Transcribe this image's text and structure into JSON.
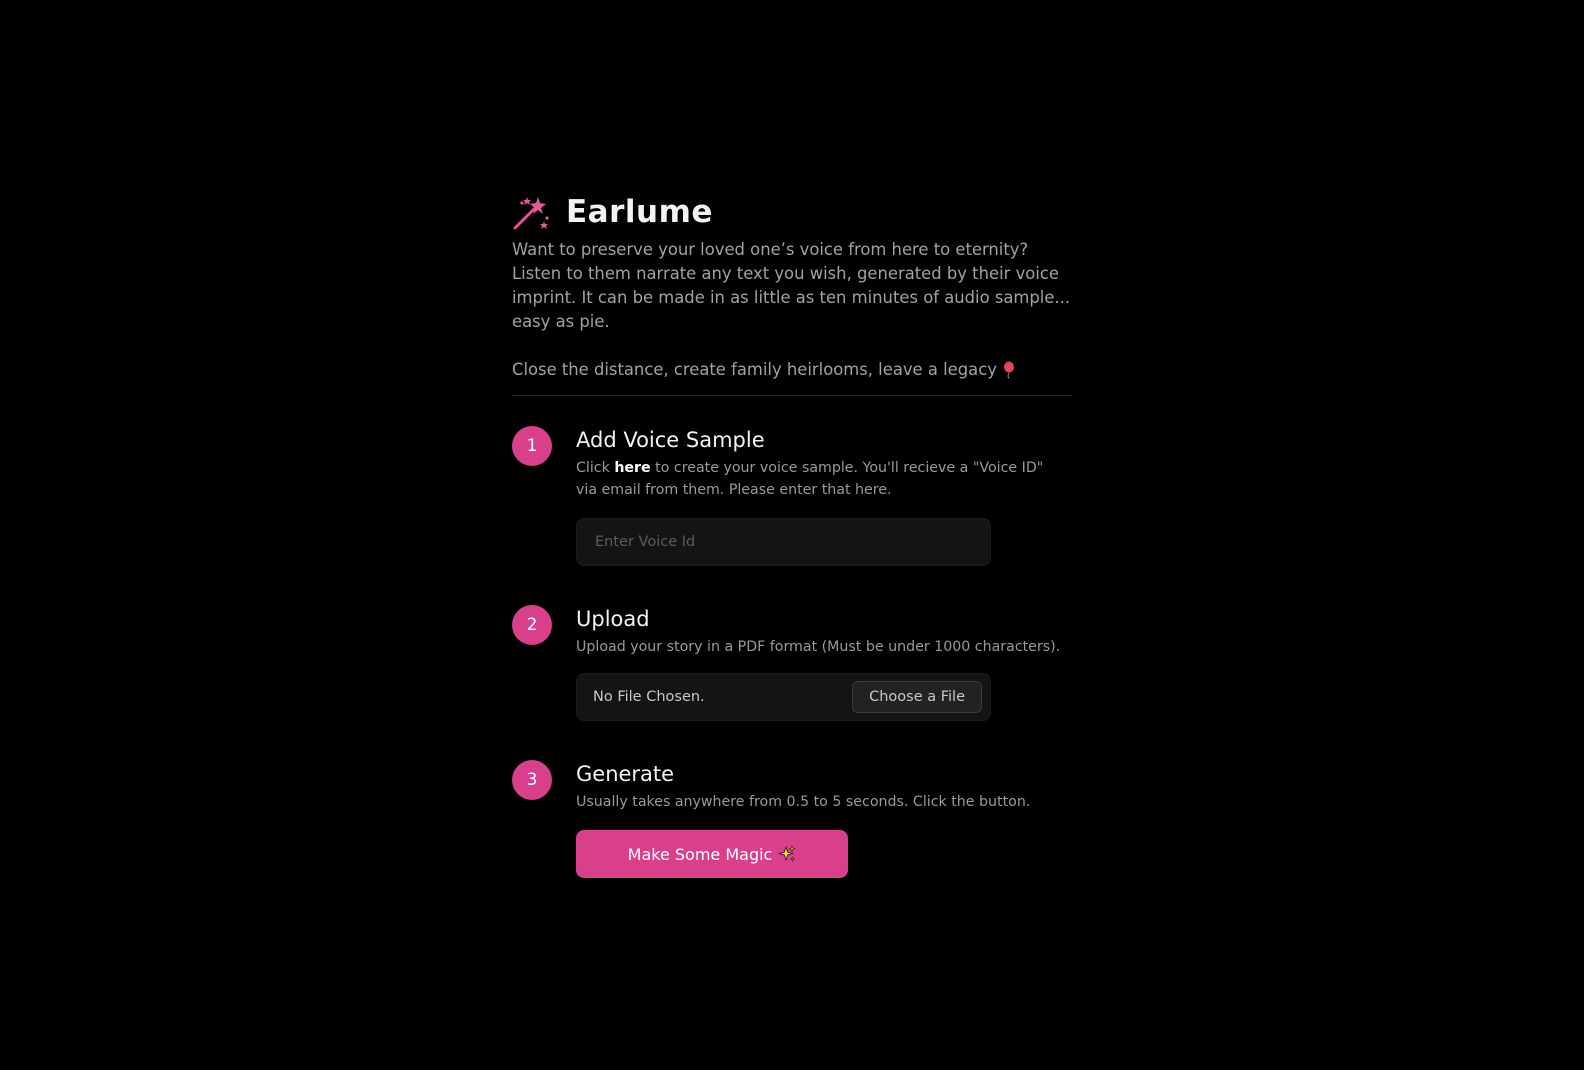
{
  "brand": {
    "name": "Earlume",
    "logo_icon": "magic-wand-icon"
  },
  "intro": {
    "text": "Want to preserve your loved one’s voice from here to eternity? Listen to them narrate any text you wish, generated by their voice imprint.  It can be made in as little as ten minutes of audio sample... easy as pie.",
    "tagline": "Close the distance, create family heirlooms, leave a legacy",
    "tagline_icon": "balloon-icon"
  },
  "steps": [
    {
      "number": "1",
      "title": "Add Voice Sample",
      "desc_before": "Click ",
      "desc_link": "here",
      "desc_after": " to create your voice sample. You'll recieve a \"Voice ID\" via email from them. Please enter that here.",
      "input_placeholder": "Enter Voice Id",
      "input_value": ""
    },
    {
      "number": "2",
      "title": "Upload",
      "desc": "Upload your story in a PDF format (Must be under 1000 characters).",
      "file_status": "No File Chosen.",
      "choose_label": "Choose a File"
    },
    {
      "number": "3",
      "title": "Generate",
      "desc": "Usually takes anywhere from 0.5 to 5 seconds. Click the button.",
      "button_label": "Make Some Magic",
      "button_icon": "sparkles-icon"
    }
  ],
  "colors": {
    "accent": "#d8408c",
    "background": "#000000"
  }
}
